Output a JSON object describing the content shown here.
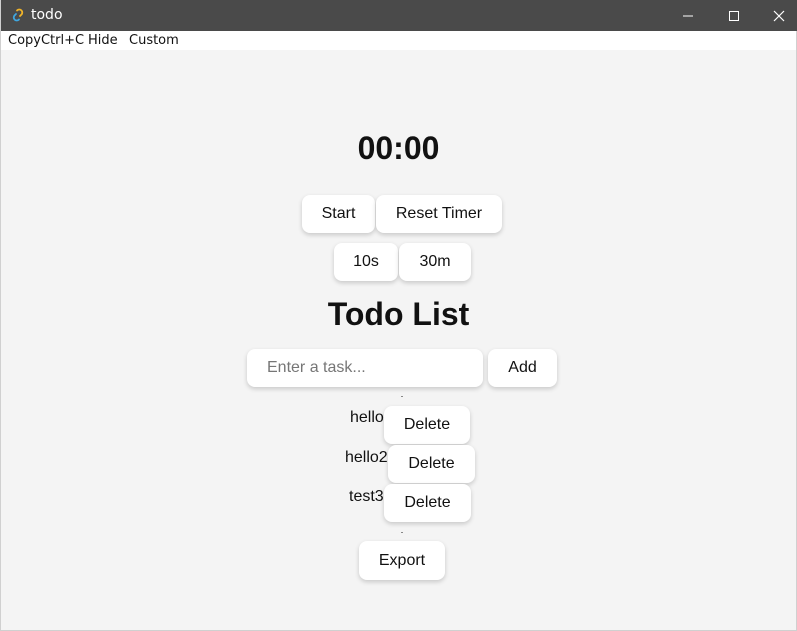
{
  "window": {
    "title": "todo",
    "icon": "link-icon",
    "controls": [
      "minimize-icon",
      "maximize-icon",
      "close-icon"
    ]
  },
  "menu": {
    "items": [
      "CopyCtrl+C",
      "Hide",
      "Custom"
    ]
  },
  "timer": {
    "display": "00:00",
    "start_label": "Start",
    "reset_label": "Reset Timer",
    "presets": [
      "10s",
      "30m"
    ]
  },
  "todo": {
    "heading": "Todo List",
    "input_value": "",
    "input_placeholder": "Enter a task...",
    "add_label": "Add",
    "tasks": [
      {
        "text": "hello",
        "delete_label": "Delete"
      },
      {
        "text": "hello2",
        "delete_label": "Delete"
      },
      {
        "text": "test3",
        "delete_label": "Delete"
      }
    ],
    "export_label": "Export"
  }
}
